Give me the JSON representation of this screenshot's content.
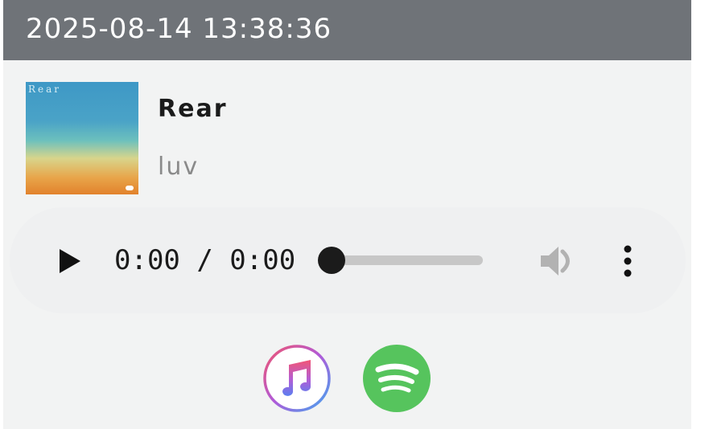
{
  "header": {
    "timestamp": "2025-08-14 13:38:36"
  },
  "track": {
    "cover_text": "Rear",
    "title": "Rear",
    "artist": "luv"
  },
  "player": {
    "current_time": "0:00",
    "separator": "/",
    "duration": "0:00",
    "time_display": "0:00 / 0:00",
    "progress": 0,
    "play_icon": "play-icon",
    "volume_icon": "volume-icon",
    "menu_icon": "more-vertical-icon"
  },
  "links": {
    "apple_music_icon": "apple-music-icon",
    "spotify_icon": "spotify-icon"
  },
  "colors": {
    "header_bg": "#6f7378",
    "card_bg": "#f2f3f3",
    "spotify_green": "#56c45d",
    "text_dark": "#1b1b1b",
    "text_muted": "#8a8a8a"
  }
}
